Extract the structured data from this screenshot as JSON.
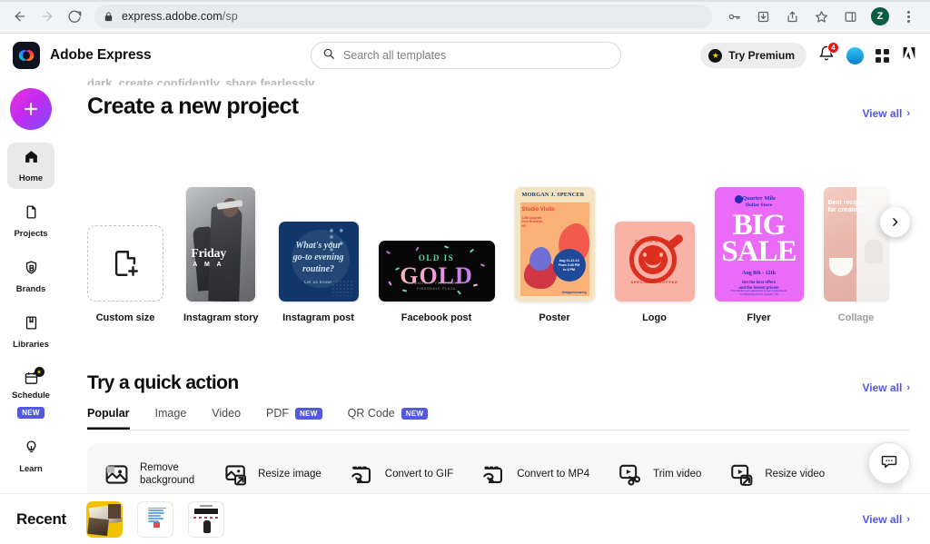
{
  "browser": {
    "url_main": "express.adobe.com",
    "url_path": "/sp",
    "back_icon": "back-arrow-icon",
    "forward_icon": "forward-arrow-icon",
    "reload_icon": "reload-icon",
    "lock_icon": "lock-icon",
    "toolbar_icons": [
      "password-key-icon",
      "install-app-icon",
      "share-icon",
      "bookmark-star-icon",
      "side-panel-icon"
    ],
    "profile_initial": "Z",
    "menu_icon": "three-dot-menu-icon"
  },
  "app_header": {
    "brand_name": "Adobe Express",
    "brand_logo_icon": "adobe-express-logo-icon",
    "search": {
      "placeholder": "Search all templates",
      "value": "",
      "icon": "search-icon"
    },
    "premium_label": "Try Premium",
    "notification_count": "4",
    "icons": [
      "bell-icon",
      "user-avatar",
      "app-grid-icon",
      "adobe-logo-icon"
    ]
  },
  "sidebar": {
    "create_button": {
      "label": "",
      "icon": "plus-icon"
    },
    "items": [
      {
        "label": "Home",
        "icon": "home-icon",
        "active": true,
        "badge": ""
      },
      {
        "label": "Projects",
        "icon": "document-icon",
        "active": false,
        "badge": ""
      },
      {
        "label": "Brands",
        "icon": "shield-badge-icon",
        "active": false,
        "badge": ""
      },
      {
        "label": "Libraries",
        "icon": "books-icon",
        "active": false,
        "badge": ""
      },
      {
        "label": "Schedule",
        "icon": "calendar-icon",
        "active": false,
        "badge": "NEW"
      },
      {
        "label": "Learn",
        "icon": "lightbulb-icon",
        "active": false,
        "badge": ""
      }
    ]
  },
  "main": {
    "cut_off_text": "dark, create confidently, share fearlessly.",
    "create_section": {
      "title": "Create a new project",
      "view_all": "View all",
      "chevron": "›",
      "templates": [
        {
          "label": "Custom size",
          "type": "custom"
        },
        {
          "label": "Instagram story",
          "type": "story",
          "art": {
            "title": "Friday",
            "subtitle": "A M A"
          }
        },
        {
          "label": "Instagram post",
          "type": "igpost",
          "art": {
            "line1": "What's your",
            "line2": "go-to evening",
            "line3": "routine?",
            "sub": "Let us know!",
            "stars": "∗ ∗ ∗\n∗ ∗ ∗"
          }
        },
        {
          "label": "Facebook post",
          "type": "fbpost",
          "art": {
            "top": "OLD IS",
            "big": "GOLD",
            "foot": "COMMUNITY FLEA MARKET\nFIRESDALE PLAZA"
          }
        },
        {
          "label": "Poster",
          "type": "poster",
          "art": {
            "title": "MORGAN J. SPENCER",
            "subtitle": "Studio Visits",
            "address": "1156 Augusta\nPark Brooklyn,\nNY",
            "circle": "Aug 11-12-13\nFrom 3:30 PM\nto 8 PM",
            "handle": "@mjspencerart.ig"
          }
        },
        {
          "label": "Logo",
          "type": "logo",
          "art": {
            "top": "CUPPA CHEER",
            "bottom": "SPECIALTY COFFEE"
          }
        },
        {
          "label": "Flyer",
          "type": "flyer",
          "art": {
            "brand1": "Quarter Mile",
            "brand2": "Dollar Store",
            "big1": "BIG",
            "big2": "SALE",
            "date": "Aug 8th - 12th",
            "note": "Get the best offers\nand the lowest prices!",
            "foot": "This Studio is an opportunity to see 3 Agricult and\n1-4 2024 Parsons St. Houston, TX"
          }
        },
        {
          "label": "Collage",
          "type": "collage",
          "faded": true,
          "art": {
            "text": "Best recipes\nfor creators"
          }
        }
      ],
      "next_button_icon": "chevron-right-icon"
    },
    "quick_action_section": {
      "title": "Try a quick action",
      "view_all": "View all",
      "chevron": "›",
      "tabs": [
        {
          "label": "Popular",
          "active": true,
          "badge": ""
        },
        {
          "label": "Image",
          "active": false,
          "badge": ""
        },
        {
          "label": "Video",
          "active": false,
          "badge": ""
        },
        {
          "label": "PDF",
          "active": false,
          "badge": "NEW"
        },
        {
          "label": "QR Code",
          "active": false,
          "badge": "NEW"
        }
      ],
      "actions": [
        {
          "label": "Remove\nbackground",
          "icon": "remove-background-icon"
        },
        {
          "label": "Resize image",
          "icon": "resize-image-icon"
        },
        {
          "label": "Convert to GIF",
          "icon": "convert-to-gif-icon"
        },
        {
          "label": "Convert to MP4",
          "icon": "convert-to-mp4-icon"
        },
        {
          "label": "Trim video",
          "icon": "trim-video-icon"
        },
        {
          "label": "Resize video",
          "icon": "resize-video-icon"
        }
      ]
    }
  },
  "chat_fab": {
    "icon": "chat-bubble-icon"
  },
  "recent": {
    "title": "Recent",
    "view_all": "View all",
    "chevron": "›",
    "items": [
      {
        "name": "photo-collage-thumbnail"
      },
      {
        "name": "blue-text-document-thumbnail"
      },
      {
        "name": "dark-header-document-thumbnail"
      }
    ]
  },
  "colors": {
    "accent": "#5258e4",
    "badge_red": "#e8140d",
    "chrome_bg": "#f1f3f4"
  }
}
